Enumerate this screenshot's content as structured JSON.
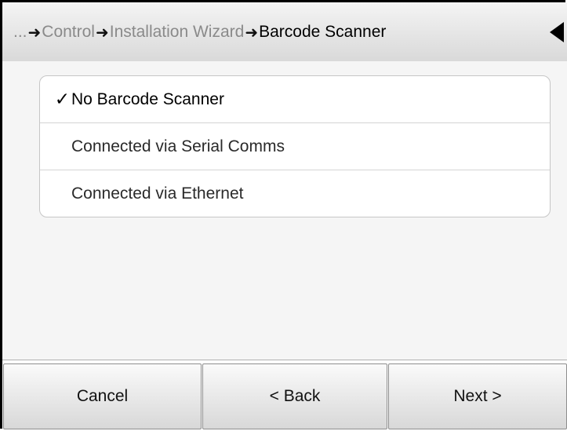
{
  "breadcrumb": {
    "ellipsis": "...",
    "items": [
      "Control",
      "Installation Wizard"
    ],
    "current": "Barcode Scanner",
    "separator": "➜"
  },
  "header": {
    "back_icon": "left-triangle-icon"
  },
  "options": [
    {
      "label": "No Barcode Scanner",
      "selected": true,
      "check": "✓"
    },
    {
      "label": "Connected via Serial Comms",
      "selected": false,
      "check": ""
    },
    {
      "label": "Connected via Ethernet",
      "selected": false,
      "check": ""
    }
  ],
  "footer": {
    "cancel_label": "Cancel",
    "back_label": "< Back",
    "next_label": "Next >"
  }
}
